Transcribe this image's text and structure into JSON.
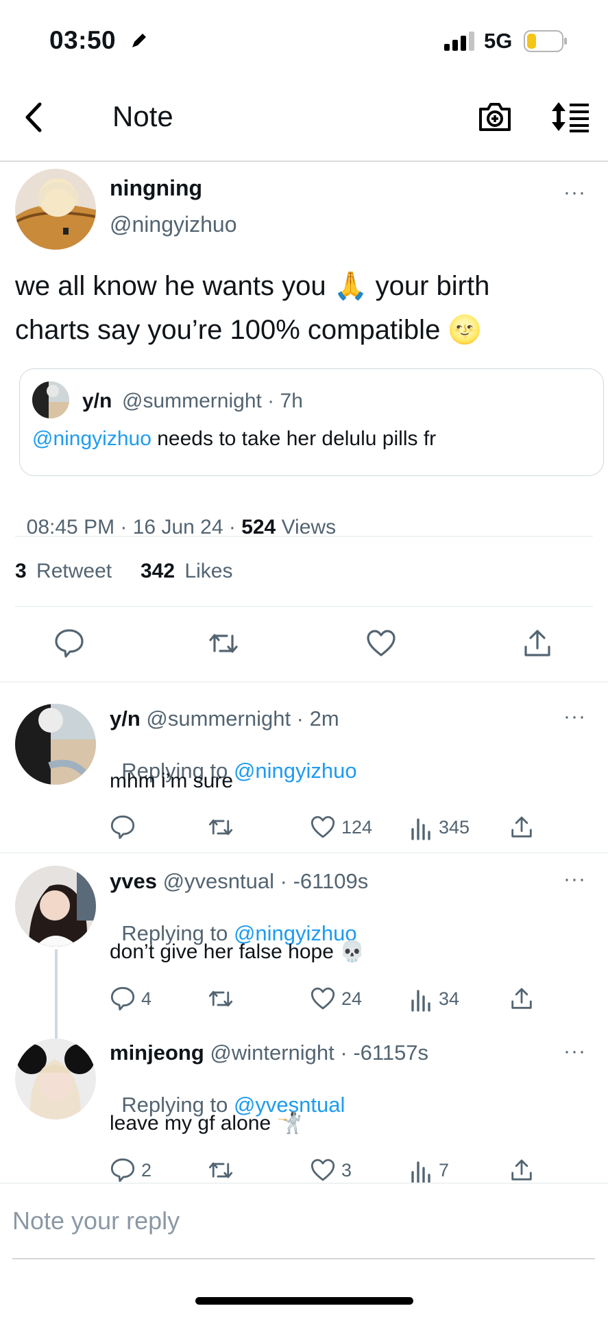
{
  "status_bar": {
    "time": "03:50",
    "network": "5G",
    "battery_color": "#f5c518"
  },
  "nav": {
    "back_icon": "chevron-left-icon",
    "title": "Note",
    "camera_icon": "camera-plus-icon",
    "sort_icon": "sort-list-icon"
  },
  "main_tweet": {
    "display_name": "ningning",
    "handle": "@ningyizhuo",
    "more": "···",
    "text_line1": "we all know he wants you 🙏 your birth",
    "text_line2": "charts say you’re 100% compatible 🌝",
    "quote": {
      "display_name": "y/n",
      "handle_time": "@summernight · 7h",
      "mention": "@ningyizhuo",
      "text": " needs to take her delulu pills fr"
    },
    "meta": {
      "time_date": "08:45 PM · 16 Jun 24 · ",
      "views_count": "524",
      "views_label": " Views"
    },
    "stats": {
      "retweet_count": "3",
      "retweet_label": "Retweet",
      "likes_count": "342",
      "likes_label": "Likes"
    }
  },
  "replies": [
    {
      "display_name": "y/n",
      "handle_time": " @summernight · 2m",
      "replying_label": "Replying to ",
      "replying_handle": "@ningyizhuo",
      "text": "mhm i’m sure",
      "comments": "",
      "likes": "124",
      "views": "345",
      "more": "···"
    },
    {
      "display_name": "yves",
      "handle_time": " @yvesntual · -61109s",
      "replying_label": "Replying to ",
      "replying_handle": "@ningyizhuo",
      "text": "don’t give her false hope 💀",
      "comments": "4",
      "likes": "24",
      "views": "34",
      "more": "···"
    },
    {
      "display_name": "minjeong",
      "handle_time": " @winternight · -61157s",
      "replying_label": "Replying to ",
      "replying_handle": "@yvesntual",
      "text": "leave my gf alone 🤺",
      "comments": "2",
      "likes": "3",
      "views": "7",
      "more": "···"
    }
  ],
  "reply_box": {
    "placeholder": "Note your reply"
  }
}
